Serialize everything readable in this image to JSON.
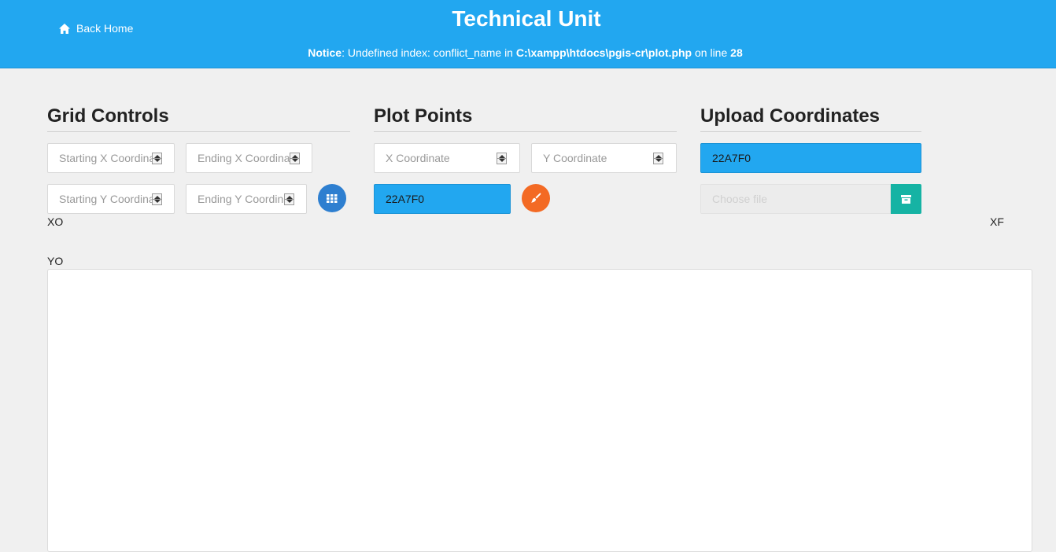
{
  "header": {
    "title": "Technical Unit",
    "back_label": "Back Home",
    "notice": {
      "label": "Notice",
      "message_before": ": Undefined index: conflict_name in ",
      "path": "C:\\xampp\\htdocs\\pgis-cr\\plot.php",
      "message_middle": " on line ",
      "line": "28"
    },
    "background_color": "#22a7f0"
  },
  "grid_controls": {
    "heading": "Grid Controls",
    "start_x_placeholder": "Starting X Coordinate",
    "end_x_placeholder": "Ending X Coordinate",
    "start_y_placeholder": "Starting Y Coordinate",
    "end_y_placeholder": "Ending Y Coordinate",
    "grid_button_icon": "grid-icon"
  },
  "plot_points": {
    "heading": "Plot Points",
    "x_placeholder": "X Coordinate",
    "y_placeholder": "Y Coordinate",
    "color_value": "22A7F0",
    "paint_button_icon": "paintbrush-icon"
  },
  "upload": {
    "heading": "Upload Coordinates",
    "color_value": "22A7F0",
    "file_placeholder": "Choose file",
    "upload_button_icon": "archive-icon"
  },
  "axes": {
    "x_origin": "XO",
    "x_final": "XF",
    "y_origin": "YO"
  },
  "colors": {
    "accent": "#22a7f0",
    "grid_button": "#2e7fd0",
    "paint_button": "#f36a24",
    "upload_button": "#16b3a4"
  }
}
